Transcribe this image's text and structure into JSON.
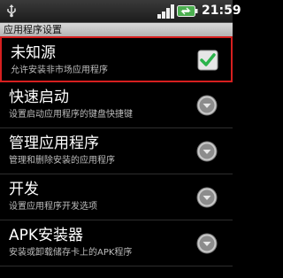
{
  "status": {
    "time": "21:59"
  },
  "screen": {
    "title": "应用程序设置"
  },
  "items": [
    {
      "title": "未知源",
      "subtitle": "允许安装非市场应用程序",
      "control": "checkbox",
      "checked": true
    },
    {
      "title": "快速启动",
      "subtitle": "设置启动应用程序的键盘快捷键",
      "control": "arrow"
    },
    {
      "title": "管理应用程序",
      "subtitle": "管理和删除安装的应用程序",
      "control": "arrow"
    },
    {
      "title": "开发",
      "subtitle": "设置应用程序开发选项",
      "control": "arrow"
    },
    {
      "title": "APK安装器",
      "subtitle": "安装或卸载储存卡上的APK程序",
      "control": "arrow"
    }
  ],
  "colors": {
    "highlight": "#d61f1f",
    "check": "#2bb34a"
  }
}
